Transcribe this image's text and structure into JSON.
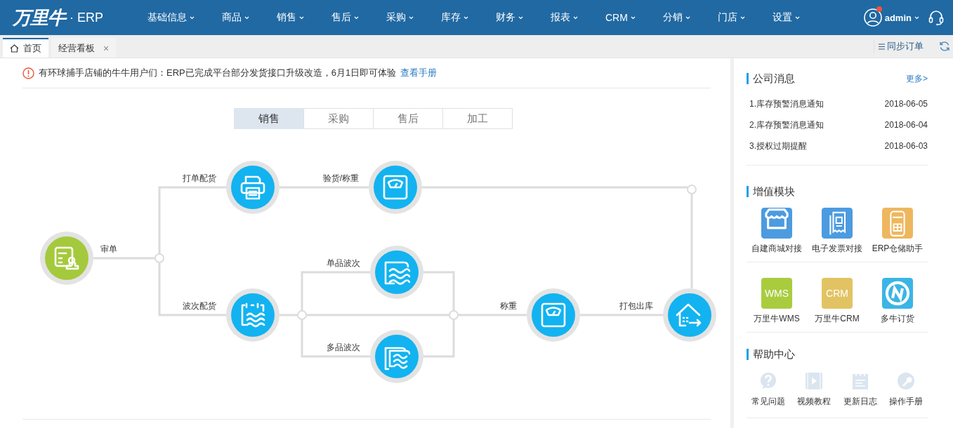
{
  "header": {
    "logo": "万里牛",
    "product": "· ERP",
    "user": "admin",
    "has_notification": true,
    "menus": [
      {
        "label": "基础信息"
      },
      {
        "label": "商品"
      },
      {
        "label": "销售"
      },
      {
        "label": "售后"
      },
      {
        "label": "采购"
      },
      {
        "label": "库存"
      },
      {
        "label": "财务"
      },
      {
        "label": "报表"
      },
      {
        "label": "CRM"
      },
      {
        "label": "分销"
      },
      {
        "label": "门店"
      },
      {
        "label": "设置"
      }
    ]
  },
  "tabs": [
    {
      "label": "首页",
      "selected": true
    },
    {
      "label": "经营看板",
      "selected": false,
      "close": "×"
    }
  ],
  "toolbar": {
    "sync": "同步订单"
  },
  "notice": {
    "text": "有环球捕手店铺的牛牛用户们：ERP已完成平台部分发货接口升级改造，6月1日即可体验",
    "link": "查看手册"
  },
  "flow_tabs": [
    {
      "label": "销售",
      "selected": true
    },
    {
      "label": "采购",
      "selected": false
    },
    {
      "label": "售后",
      "selected": false
    },
    {
      "label": "加工",
      "selected": false
    }
  ],
  "flow_nodes": [
    {
      "label": "审单",
      "color": "#a5c93c"
    },
    {
      "label": "打单配货",
      "color": "#12b3f0"
    },
    {
      "label": "验货/称重",
      "color": "#12b3f0"
    },
    {
      "label": "波次配货",
      "color": "#12b3f0"
    },
    {
      "label": "单品波次",
      "color": "#12b3f0"
    },
    {
      "label": "多品波次",
      "color": "#12b3f0"
    },
    {
      "label": "称重",
      "color": "#12b3f0"
    },
    {
      "label": "打包出库",
      "color": "#12b3f0"
    }
  ],
  "news": {
    "title": "公司消息",
    "more": "更多>",
    "items": [
      {
        "title": "1.库存预警消息通知",
        "date": "2018-06-05"
      },
      {
        "title": "2.库存预警消息通知",
        "date": "2018-06-04"
      },
      {
        "title": "3.授权过期提醒",
        "date": "2018-06-03"
      }
    ]
  },
  "modules": {
    "title": "增值模块",
    "rows": [
      [
        {
          "kind": "icon",
          "label": "自建商城对接",
          "color": "#4c9be0"
        },
        {
          "kind": "icon",
          "label": "电子发票对接",
          "color": "#4c9be0"
        },
        {
          "kind": "icon",
          "label": "ERP仓储助手",
          "color": "#eeb75e"
        }
      ],
      [
        {
          "kind": "text",
          "tile_text": "WMS",
          "label": "万里牛WMS",
          "color": "#a9cc3f"
        },
        {
          "kind": "text",
          "tile_text": "CRM",
          "label": "万里牛CRM",
          "color": "#e2c363"
        },
        {
          "kind": "icon",
          "label": "多牛订货",
          "color": "#3bb5e6"
        }
      ]
    ]
  },
  "help": {
    "title": "帮助中心",
    "items": [
      {
        "label": "常见问题"
      },
      {
        "label": "视频教程"
      },
      {
        "label": "更新日志"
      },
      {
        "label": "操作手册"
      }
    ]
  }
}
